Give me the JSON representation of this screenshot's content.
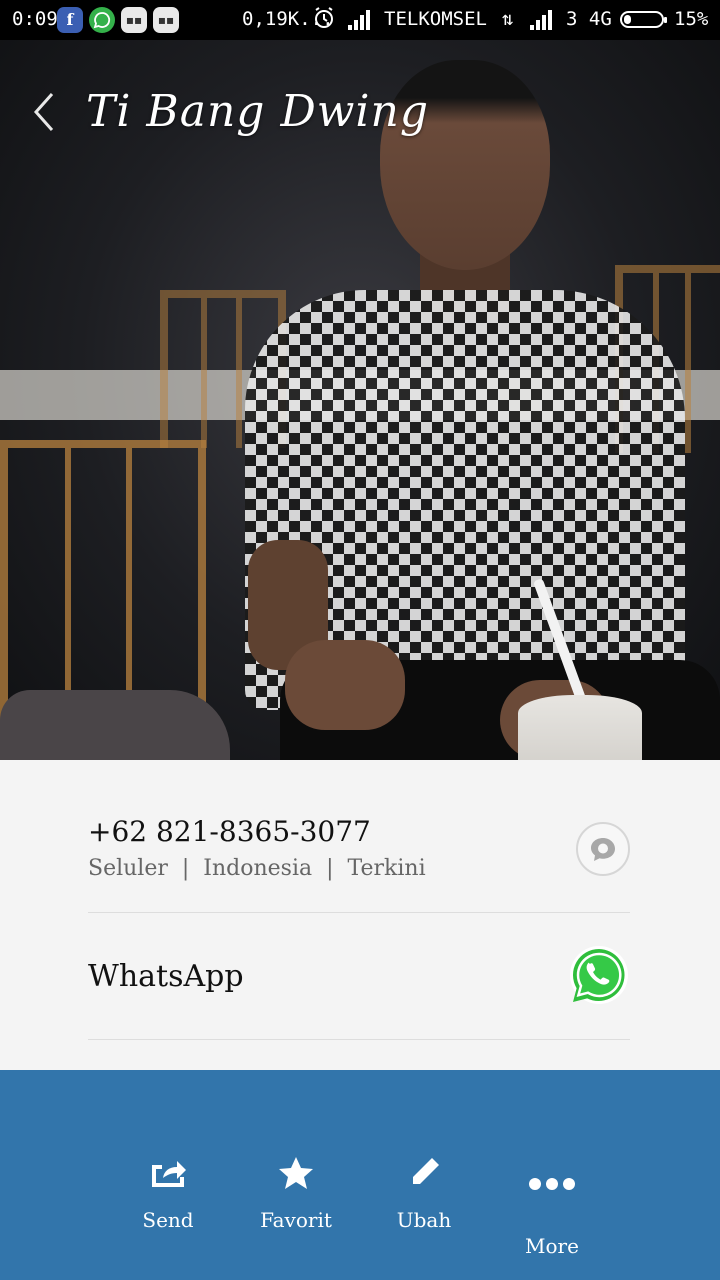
{
  "status_bar": {
    "time": "0:09",
    "notification_icons": [
      "facebook-icon",
      "whatsapp-icon",
      "bbm-icon",
      "bbm-icon"
    ],
    "data_speed": "0,19K...",
    "carrier": "TELKOMSEL",
    "network": "3 4G",
    "battery": "15%"
  },
  "header": {
    "contact_name": "Ti Bang Dwing"
  },
  "phone": {
    "number": "+62 821-8365-3077",
    "type": "Seluler",
    "region": "Indonesia",
    "recency": "Terkini",
    "separator": "|"
  },
  "whatsapp": {
    "label": "WhatsApp"
  },
  "actions": {
    "send": "Send",
    "favorite": "Favorit",
    "edit": "Ubah",
    "more": "More"
  },
  "colors": {
    "bottom_bar": "#3275ab",
    "whatsapp_green": "#2fbe3c",
    "details_bg": "#f4f4f4"
  }
}
